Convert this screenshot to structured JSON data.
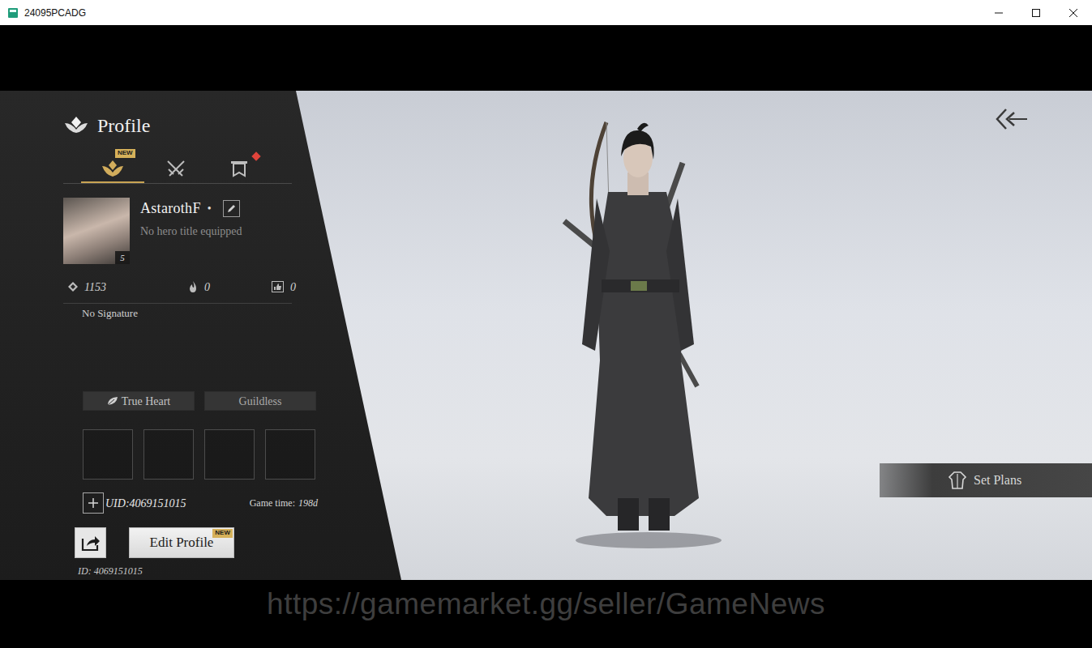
{
  "window": {
    "title": "24095PCADG"
  },
  "profile": {
    "heading": "Profile",
    "tabs": [
      {
        "kind": "emblem",
        "badge": "NEW",
        "selected": true,
        "notification": false
      },
      {
        "kind": "swords",
        "selected": false,
        "notification": false
      },
      {
        "kind": "banner",
        "selected": false,
        "notification": true
      }
    ],
    "player": {
      "name": "AstarothF",
      "status_dot": "•",
      "title": "No hero title equipped",
      "level": "5",
      "signature": "No Signature"
    },
    "stats": [
      {
        "kind": "power",
        "value": "1153"
      },
      {
        "kind": "heat",
        "value": "0"
      },
      {
        "kind": "likes",
        "value": "0"
      }
    ],
    "tags": [
      {
        "kind": "sect",
        "label": "True Heart"
      },
      {
        "kind": "guild",
        "label": "Guildless"
      }
    ],
    "slots": [
      {
        "filled": false
      },
      {
        "filled": false
      },
      {
        "filled": false
      },
      {
        "filled": false
      }
    ],
    "uid": "UID:4069151015",
    "game_time": {
      "label": "Game time:",
      "value": "198d"
    },
    "edit_button": {
      "label": "Edit Profile",
      "badge": "NEW"
    },
    "id_line": "ID: 4069151015"
  },
  "set_plans": {
    "label": "Set Plans"
  },
  "watermark": "https://gamemarket.gg/seller/GameNews"
}
